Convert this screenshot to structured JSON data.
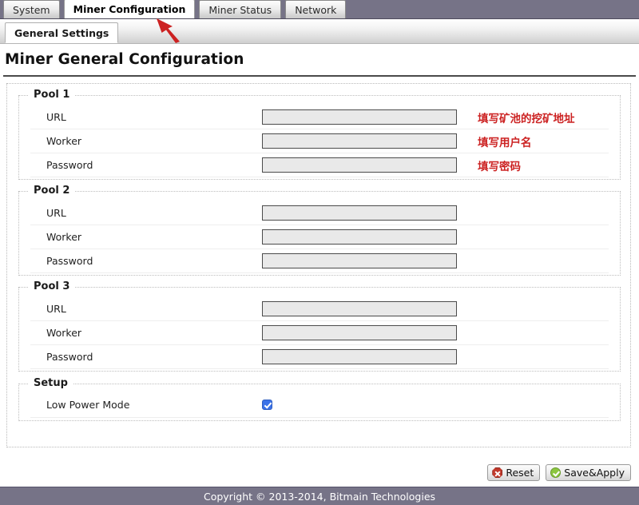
{
  "tabs": [
    {
      "label": "System",
      "active": false
    },
    {
      "label": "Miner Configuration",
      "active": true
    },
    {
      "label": "Miner Status",
      "active": false
    },
    {
      "label": "Network",
      "active": false
    }
  ],
  "subtabs": [
    {
      "label": "General Settings",
      "active": true
    }
  ],
  "page_title": "Miner General Configuration",
  "pools": [
    {
      "legend": "Pool 1",
      "rows": [
        {
          "label": "URL",
          "value": "",
          "hint": "填写矿池的挖矿地址"
        },
        {
          "label": "Worker",
          "value": "",
          "hint": "填写用户名"
        },
        {
          "label": "Password",
          "value": "",
          "hint": "填写密码"
        }
      ]
    },
    {
      "legend": "Pool 2",
      "rows": [
        {
          "label": "URL",
          "value": "",
          "hint": ""
        },
        {
          "label": "Worker",
          "value": "",
          "hint": ""
        },
        {
          "label": "Password",
          "value": "",
          "hint": ""
        }
      ]
    },
    {
      "legend": "Pool 3",
      "rows": [
        {
          "label": "URL",
          "value": "",
          "hint": ""
        },
        {
          "label": "Worker",
          "value": "",
          "hint": ""
        },
        {
          "label": "Password",
          "value": "",
          "hint": ""
        }
      ]
    }
  ],
  "setup": {
    "legend": "Setup",
    "low_power_label": "Low Power Mode",
    "low_power_checked": true
  },
  "buttons": {
    "reset_label": "Reset",
    "save_label": "Save&Apply",
    "reset_icon": "reset-error-icon",
    "save_icon": "check-circle-icon"
  },
  "footer": {
    "copyright": "Copyright © 2013-2014, Bitmain Technologies"
  },
  "annotation": {
    "arrow_icon": "red-arrow-icon",
    "arrow_color": "#cc2222"
  },
  "colors": {
    "chrome_bar": "#767387",
    "accent_red": "#cc2222",
    "checkbox_blue": "#3b72e8",
    "field_bg": "#e9e9e9"
  }
}
